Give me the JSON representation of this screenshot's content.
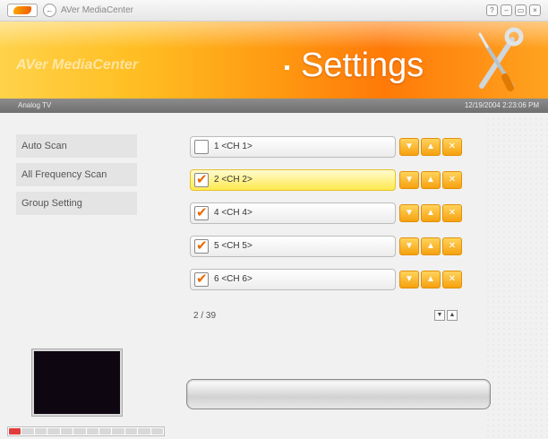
{
  "window": {
    "app_title": "AVer MediaCenter",
    "back_symbol": "←",
    "controls": [
      "?",
      "–",
      "▭",
      "×"
    ]
  },
  "banner": {
    "brand": "AVer MediaCenter",
    "heading": "Settings",
    "icon": "wrench-screwdriver-icon"
  },
  "status": {
    "source": "Analog TV",
    "datetime": "12/19/2004 2:23:06 PM"
  },
  "menu": {
    "items": [
      {
        "label": "Auto Scan"
      },
      {
        "label": "All Frequency Scan"
      },
      {
        "label": "Group Setting"
      }
    ]
  },
  "channels": {
    "rows": [
      {
        "label": "1  <CH 1>",
        "checked": false,
        "selected": false
      },
      {
        "label": "2  <CH 2>",
        "checked": true,
        "selected": true
      },
      {
        "label": "4  <CH 4>",
        "checked": true,
        "selected": false
      },
      {
        "label": "5  <CH 5>",
        "checked": true,
        "selected": false
      },
      {
        "label": "6  <CH 6>",
        "checked": true,
        "selected": false
      }
    ],
    "row_buttons": [
      "▼",
      "▲",
      "✕"
    ],
    "checkmark": "✔",
    "page_count": "2 / 39",
    "pager": [
      "▼",
      "▲"
    ]
  },
  "scan_progress": {
    "fraction": 0
  },
  "colors": {
    "accent": "#f6a110",
    "selected_row": "#ffe94e",
    "banner_orange": "#ff7a08"
  }
}
